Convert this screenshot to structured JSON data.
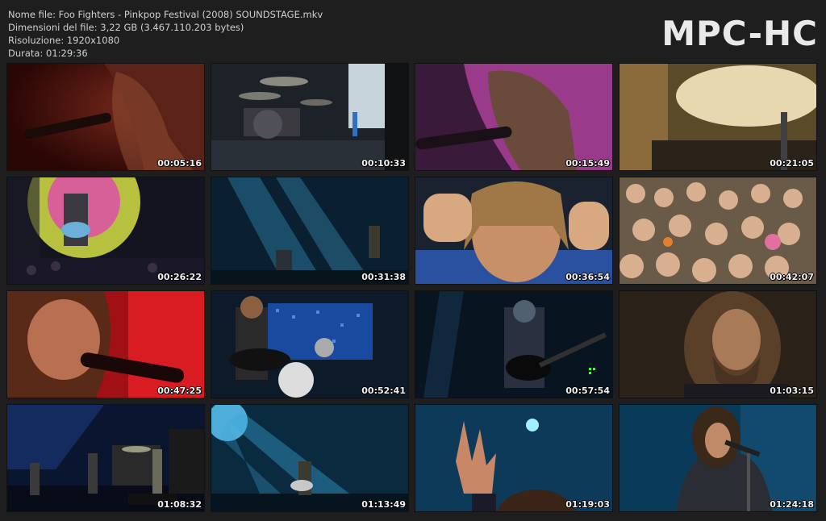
{
  "info": {
    "file_name": "Nome file: Foo Fighters - Pinkpop Festival (2008) SOUNDSTAGE.mkv",
    "file_size": "Dimensioni del file: 3,22 GB (3.467.110.203 bytes)",
    "resolution": "Risoluzione: 1920x1080",
    "duration": "Durata: 01:29:36"
  },
  "brand": "MPC-HC",
  "thumbnails": [
    {
      "time": "00:05:16",
      "scene": "red-closeup-singer-icon"
    },
    {
      "time": "00:10:33",
      "scene": "outdoor-drumkit-stage-icon"
    },
    {
      "time": "00:15:49",
      "scene": "purple-closeup-singer-icon"
    },
    {
      "time": "00:21:05",
      "scene": "cymbal-closeup-icon"
    },
    {
      "time": "00:26:22",
      "scene": "guitarist-crowd-icon"
    },
    {
      "time": "00:31:38",
      "scene": "blue-stage-lights-icon"
    },
    {
      "time": "00:36:54",
      "scene": "drummer-closeup-icon"
    },
    {
      "time": "00:42:07",
      "scene": "crowd-icon"
    },
    {
      "time": "00:47:25",
      "scene": "red-closeup-singer-icon"
    },
    {
      "time": "00:52:41",
      "scene": "band-led-wall-icon"
    },
    {
      "time": "00:57:54",
      "scene": "guitarist-dark-blue-icon"
    },
    {
      "time": "01:03:15",
      "scene": "bearded-closeup-icon"
    },
    {
      "time": "01:08:32",
      "scene": "full-band-stage-icon"
    },
    {
      "time": "01:13:49",
      "scene": "blue-stage-lights-icon"
    },
    {
      "time": "01:19:03",
      "scene": "hand-closeup-icon"
    },
    {
      "time": "01:24:18",
      "scene": "singer-mic-blue-icon"
    }
  ]
}
